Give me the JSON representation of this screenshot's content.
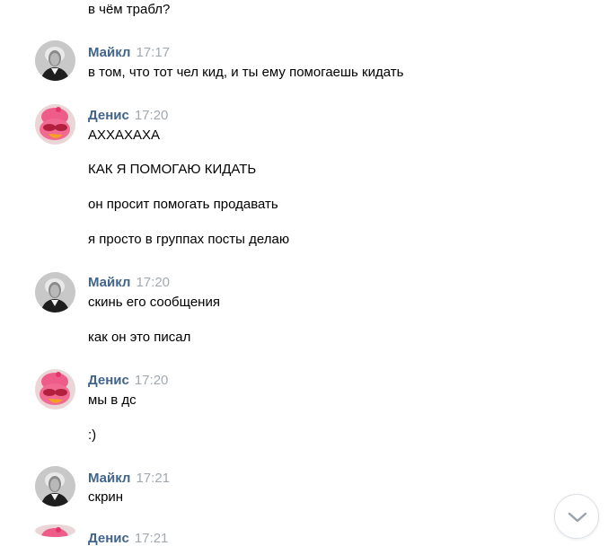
{
  "messages": {
    "m0": "в чём трабл?",
    "g1": {
      "author": "Майкл",
      "time": "17:17",
      "lines": [
        "в том, что тот чел кид, и ты ему помогаешь кидать"
      ]
    },
    "g2": {
      "author": "Денис",
      "time": "17:20",
      "lines": [
        "АХХАХАХА",
        "КАК Я ПОМОГАЮ КИДАТЬ",
        "он просит помогать продавать",
        "я просто в группах посты делаю"
      ]
    },
    "g3": {
      "author": "Майкл",
      "time": "17:20",
      "lines": [
        "скинь его сообщения",
        "как он это писал"
      ]
    },
    "g4": {
      "author": "Денис",
      "time": "17:20",
      "lines": [
        "мы в дс",
        ":)"
      ]
    },
    "g5": {
      "author": "Майкл",
      "time": "17:21",
      "lines": [
        "скрин"
      ]
    },
    "g6": {
      "author": "Денис",
      "time": "17:21"
    }
  },
  "icons": {
    "avatar_michael": "portrait-avatar-icon",
    "avatar_denis": "pink-bird-avatar-icon",
    "scroll": "chevron-down-icon"
  },
  "colors": {
    "author_name": "#42648b",
    "time": "#a2a9b0",
    "scroll_border": "#dce1e6"
  }
}
